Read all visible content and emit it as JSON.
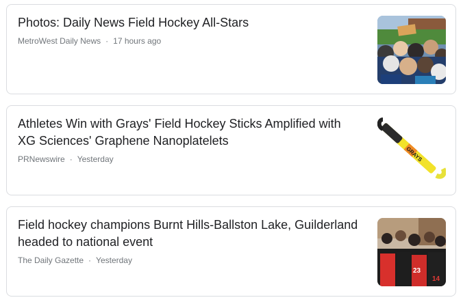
{
  "articles": [
    {
      "title": "Photos: Daily News Field Hockey All-Stars",
      "source": "MetroWest Daily News",
      "separator": "·",
      "time": "17 hours ago",
      "thumbnail_icon": "team-photo-image"
    },
    {
      "title": "Athletes Win with Grays' Field Hockey Sticks Amplified with XG Sciences' Graphene Nanoplatelets",
      "source": "PRNewswire",
      "separator": "·",
      "time": "Yesterday",
      "thumbnail_icon": "hockey-stick-image",
      "stick_brand_text": "GRAYS"
    },
    {
      "title": "Field hockey champions Burnt Hills-Ballston Lake, Guilderland headed to national event",
      "source": "The Daily Gazette",
      "separator": "·",
      "time": "Yesterday",
      "thumbnail_icon": "team-huddle-image",
      "jersey_numbers": [
        "23",
        "14"
      ]
    }
  ]
}
